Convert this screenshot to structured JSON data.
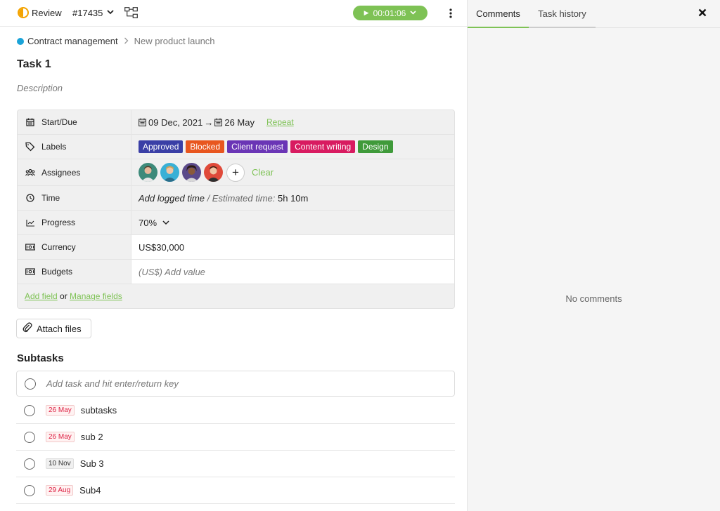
{
  "header": {
    "status_label": "Review",
    "task_id": "#17435",
    "timer": "00:01:06"
  },
  "breadcrumb": {
    "parent": "Contract management",
    "current": "New product launch"
  },
  "task": {
    "title": "Task 1",
    "description_placeholder": "Description"
  },
  "fields": {
    "start_due": {
      "label": "Start/Due",
      "start": "09 Dec, 2021",
      "arrow": "→",
      "due": "26 May",
      "repeat": "Repeat"
    },
    "labels": {
      "label": "Labels",
      "tags": [
        {
          "text": "Approved",
          "color": "#3a3fa6"
        },
        {
          "text": "Blocked",
          "color": "#e8561f"
        },
        {
          "text": "Client request",
          "color": "#6a35b5"
        },
        {
          "text": "Content writing",
          "color": "#d81b60"
        },
        {
          "text": "Design",
          "color": "#3f9a3a"
        }
      ]
    },
    "assignees": {
      "label": "Assignees",
      "add": "+",
      "clear": "Clear"
    },
    "time": {
      "label": "Time",
      "logged": "Add logged time",
      "sep": " / Estimated time: ",
      "estimate": "5h 10m"
    },
    "progress": {
      "label": "Progress",
      "value": "70%"
    },
    "currency": {
      "label": "Currency",
      "value": "US$30,000"
    },
    "budgets": {
      "label": "Budgets",
      "placeholder": "(US$) Add value"
    },
    "footer": {
      "add_field": "Add field",
      "or": " or ",
      "manage_fields": "Manage fields"
    }
  },
  "attach": {
    "label": "Attach files"
  },
  "subtasks": {
    "heading": "Subtasks",
    "add_placeholder": "Add task and hit enter/return key",
    "items": [
      {
        "due": "26 May",
        "name": "subtasks",
        "overdue": true
      },
      {
        "due": "26 May",
        "name": "sub 2",
        "overdue": true
      },
      {
        "due": "10 Nov",
        "name": "Sub 3",
        "overdue": false
      },
      {
        "due": "29 Aug",
        "name": "Sub4",
        "overdue": true
      }
    ]
  },
  "sidebar": {
    "tabs": [
      "Comments",
      "Task history"
    ],
    "empty": "No comments"
  },
  "colors": {
    "accent": "#7ec255",
    "status": "#f4a300",
    "breadcrumb_dot": "#1aa3d8"
  }
}
